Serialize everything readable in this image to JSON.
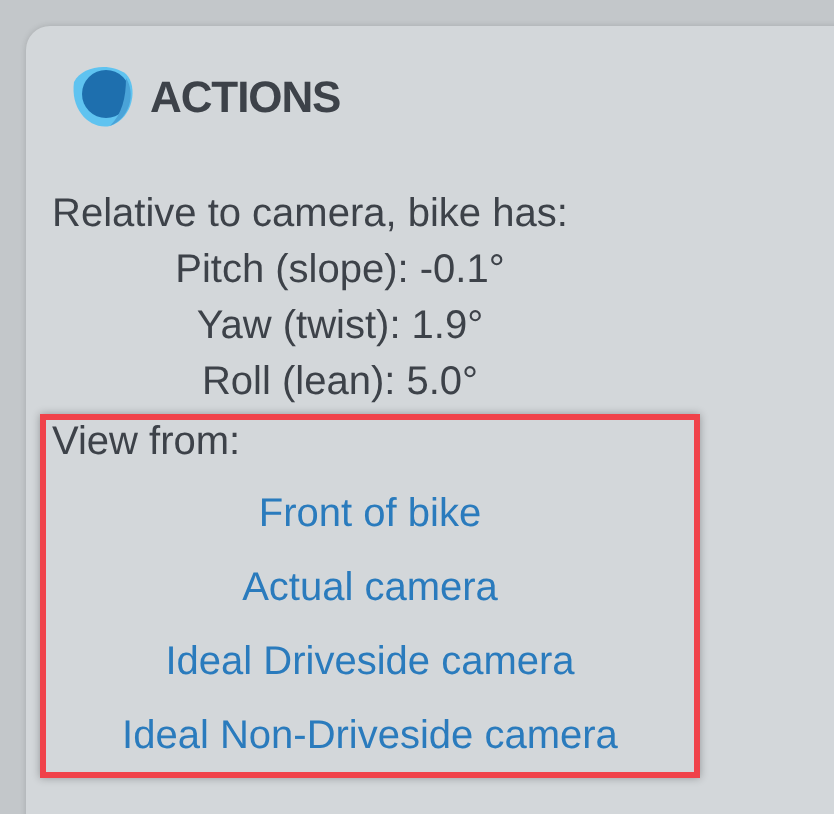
{
  "panel": {
    "title": "ACTIONS"
  },
  "orientation": {
    "heading": "Relative to camera, bike has:",
    "lines": [
      "Pitch (slope): -0.1°",
      "Yaw (twist): 1.9°",
      "Roll (lean): 5.0°"
    ]
  },
  "view_from": {
    "label": "View from:",
    "links": [
      "Front of bike",
      "Actual camera",
      "Ideal Driveside camera",
      "Ideal Non-Driveside camera"
    ]
  }
}
